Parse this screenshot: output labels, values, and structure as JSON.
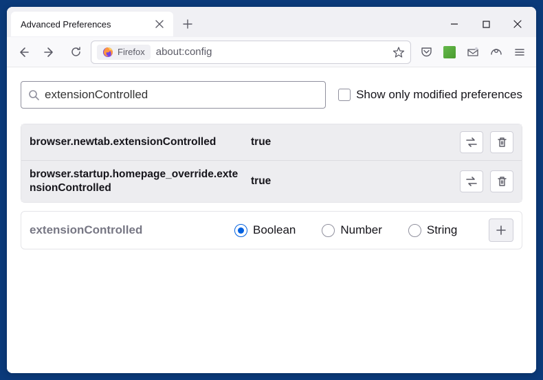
{
  "window": {
    "tab_title": "Advanced Preferences"
  },
  "urlbar": {
    "identity_label": "Firefox",
    "url": "about:config"
  },
  "search": {
    "value": "extensionControlled",
    "show_modified_label": "Show only modified preferences"
  },
  "prefs": [
    {
      "name": "browser.newtab.extensionControlled",
      "value": "true"
    },
    {
      "name": "browser.startup.homepage_override.extensionControlled",
      "value": "true"
    }
  ],
  "new_pref": {
    "name": "extensionControlled",
    "types": {
      "boolean": "Boolean",
      "number": "Number",
      "string": "String"
    }
  }
}
